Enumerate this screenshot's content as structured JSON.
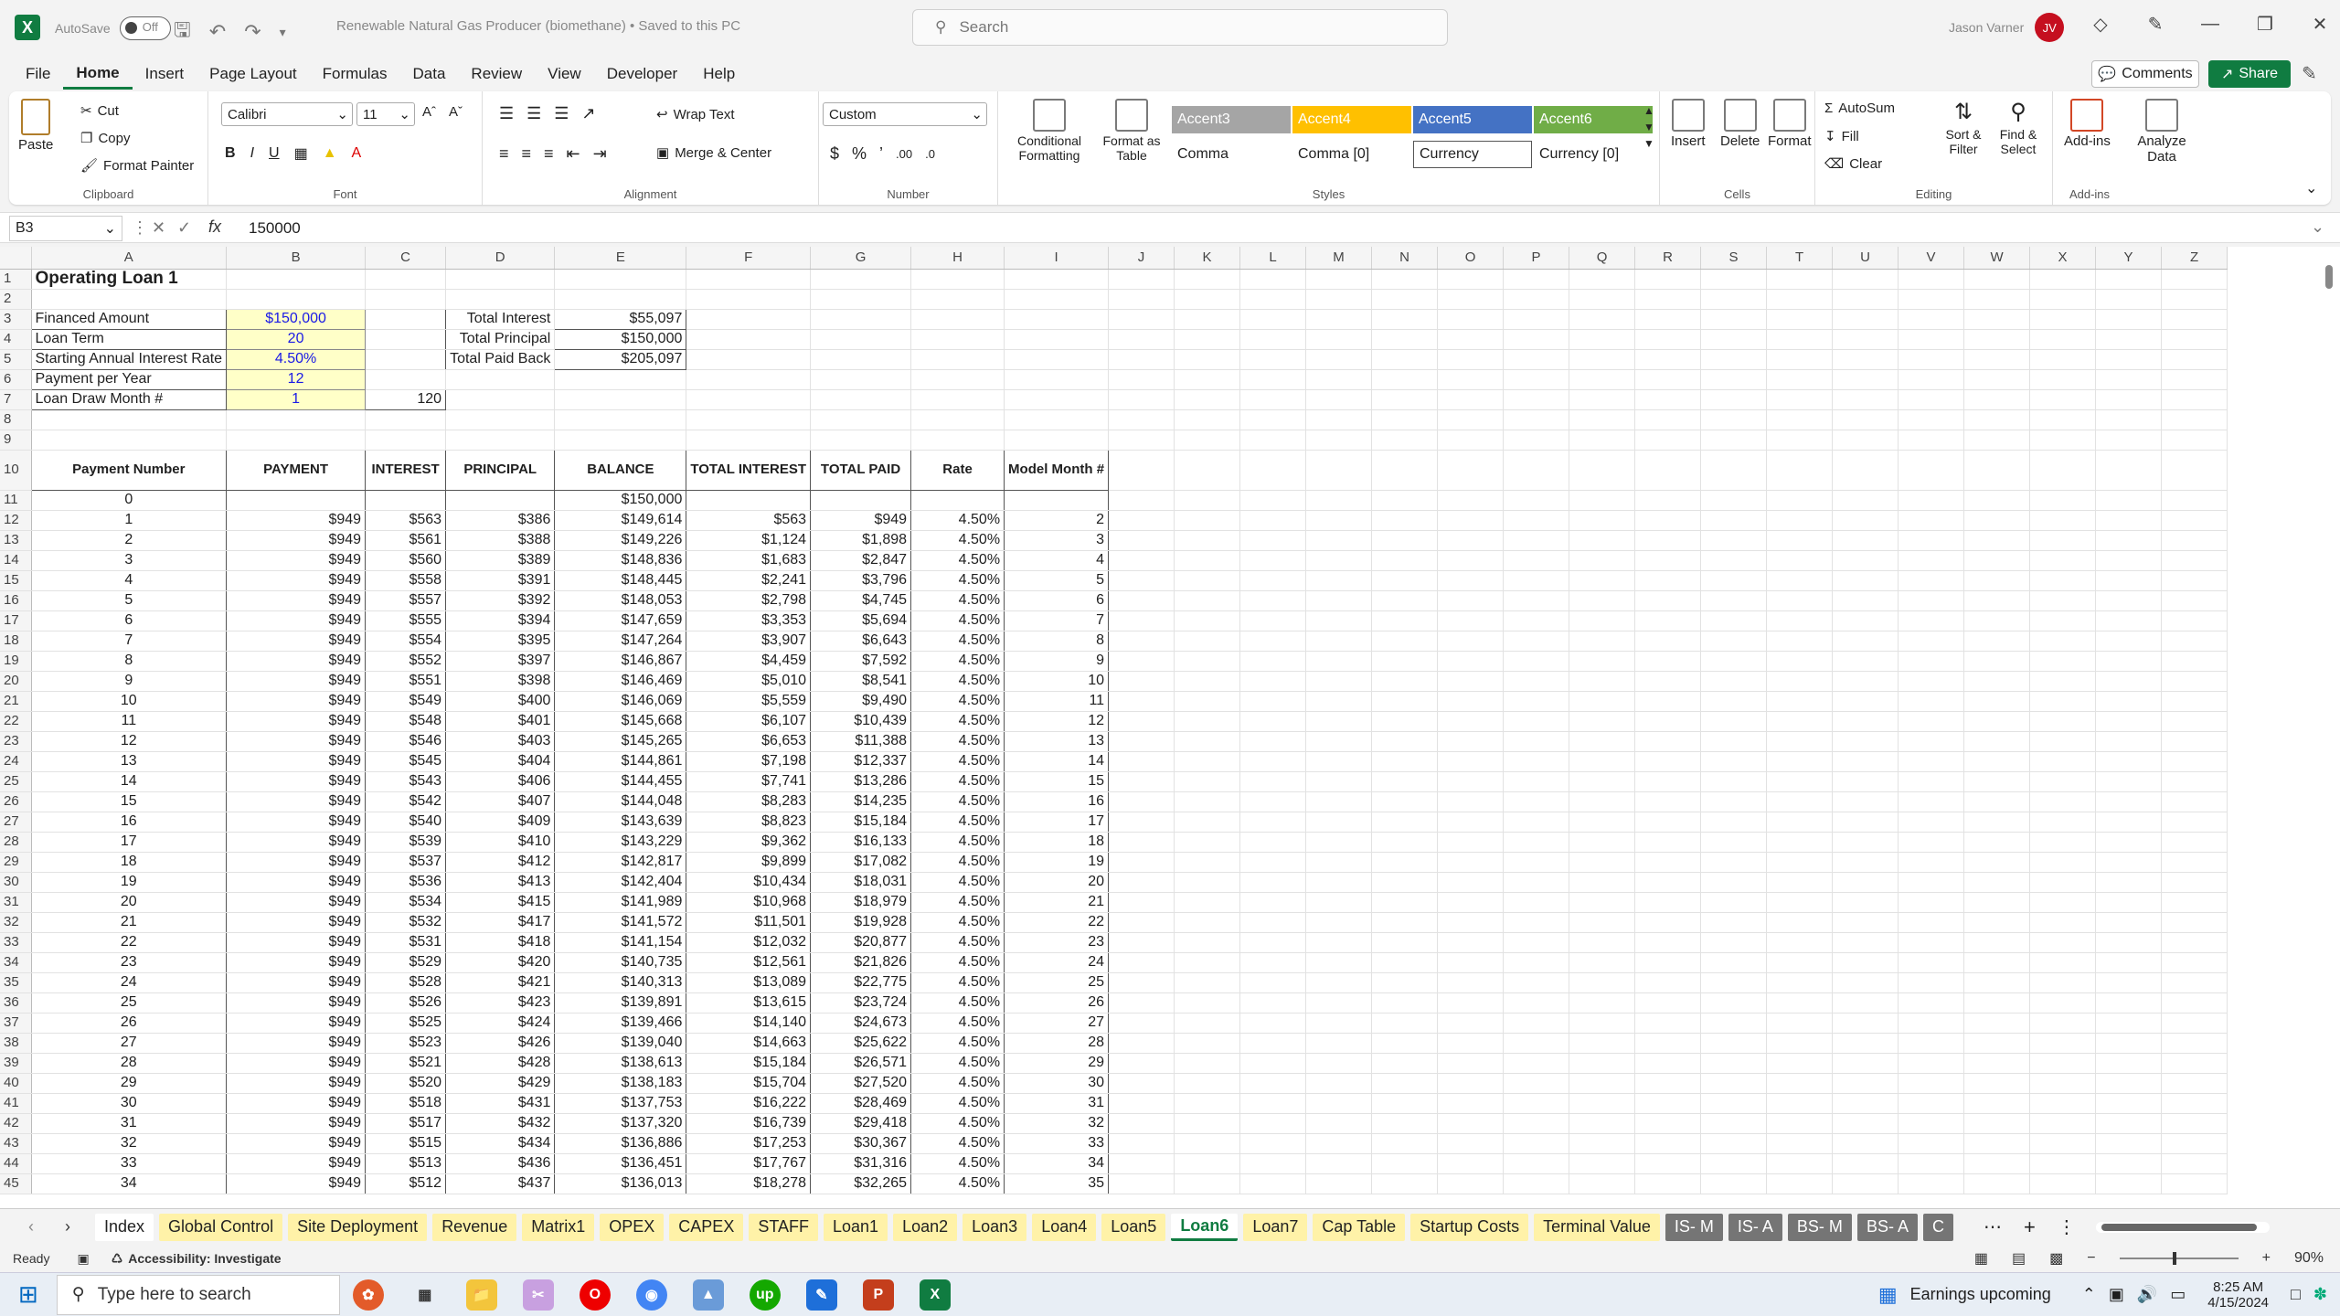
{
  "title": {
    "autosave_label": "AutoSave",
    "autosave_state": "Off",
    "doc_title": "Renewable Natural Gas Producer (biomethane) • Saved to this PC",
    "search_placeholder": "Search",
    "user_name": "Jason Varner",
    "user_initials": "JV"
  },
  "menu": {
    "items": [
      "File",
      "Home",
      "Insert",
      "Page Layout",
      "Formulas",
      "Data",
      "Review",
      "View",
      "Developer",
      "Help"
    ],
    "active": "Home",
    "comments": "Comments",
    "share": "Share"
  },
  "ribbon": {
    "clipboard": {
      "paste": "Paste",
      "cut": "Cut",
      "copy": "Copy",
      "format_painter": "Format Painter",
      "label": "Clipboard"
    },
    "font": {
      "name": "Calibri",
      "size": "11",
      "label": "Font"
    },
    "alignment": {
      "wrap": "Wrap Text",
      "merge": "Merge & Center",
      "label": "Alignment"
    },
    "number": {
      "format": "Custom",
      "label": "Number"
    },
    "styles": {
      "conditional": "Conditional Formatting",
      "format_table": "Format as Table",
      "cells": [
        "Accent3",
        "Accent4",
        "Accent5",
        "Accent6",
        "Comma",
        "Comma [0]",
        "Currency",
        "Currency [0]"
      ],
      "label": "Styles"
    },
    "cells": {
      "insert": "Insert",
      "delete": "Delete",
      "format": "Format",
      "label": "Cells"
    },
    "editing": {
      "autosum": "AutoSum",
      "fill": "Fill",
      "clear": "Clear",
      "sort": "Sort & Filter",
      "find": "Find & Select",
      "label": "Editing"
    },
    "addins": {
      "addins": "Add-ins",
      "analyze": "Analyze Data",
      "label": "Add-ins"
    }
  },
  "formula_bar": {
    "cell_ref": "B3",
    "fx": "fx",
    "value": "150000"
  },
  "columns": [
    "A",
    "B",
    "C",
    "D",
    "E",
    "F",
    "G",
    "H",
    "I",
    "J",
    "K",
    "L",
    "M",
    "N",
    "O",
    "P",
    "Q",
    "R",
    "S",
    "T",
    "U",
    "V",
    "W",
    "X",
    "Y",
    "Z"
  ],
  "sheet": {
    "title": "Operating Loan 1",
    "inputs": [
      [
        "Financed Amount",
        "$150,000"
      ],
      [
        "Loan Term",
        "20"
      ],
      [
        "Starting Annual Interest Rate",
        "4.50%"
      ],
      [
        "Payment per Year",
        "12"
      ],
      [
        "Loan Draw Month #",
        "1"
      ]
    ],
    "draw_month_value": "120",
    "summary": [
      [
        "Total Interest",
        "$55,097"
      ],
      [
        "Total Principal",
        "$150,000"
      ],
      [
        "Total Paid Back",
        "$205,097"
      ]
    ],
    "headers": [
      "Payment Number",
      "PAYMENT",
      "INTEREST",
      "PRINCIPAL",
      "BALANCE",
      "TOTAL INTEREST",
      "TOTAL PAID",
      "Rate",
      "Model Month #"
    ],
    "row0": [
      "0",
      "",
      "",
      "",
      "$150,000",
      "",
      "",
      "",
      ""
    ],
    "rows": [
      [
        "1",
        "$949",
        "$563",
        "$386",
        "$149,614",
        "$563",
        "$949",
        "4.50%",
        "2"
      ],
      [
        "2",
        "$949",
        "$561",
        "$388",
        "$149,226",
        "$1,124",
        "$1,898",
        "4.50%",
        "3"
      ],
      [
        "3",
        "$949",
        "$560",
        "$389",
        "$148,836",
        "$1,683",
        "$2,847",
        "4.50%",
        "4"
      ],
      [
        "4",
        "$949",
        "$558",
        "$391",
        "$148,445",
        "$2,241",
        "$3,796",
        "4.50%",
        "5"
      ],
      [
        "5",
        "$949",
        "$557",
        "$392",
        "$148,053",
        "$2,798",
        "$4,745",
        "4.50%",
        "6"
      ],
      [
        "6",
        "$949",
        "$555",
        "$394",
        "$147,659",
        "$3,353",
        "$5,694",
        "4.50%",
        "7"
      ],
      [
        "7",
        "$949",
        "$554",
        "$395",
        "$147,264",
        "$3,907",
        "$6,643",
        "4.50%",
        "8"
      ],
      [
        "8",
        "$949",
        "$552",
        "$397",
        "$146,867",
        "$4,459",
        "$7,592",
        "4.50%",
        "9"
      ],
      [
        "9",
        "$949",
        "$551",
        "$398",
        "$146,469",
        "$5,010",
        "$8,541",
        "4.50%",
        "10"
      ],
      [
        "10",
        "$949",
        "$549",
        "$400",
        "$146,069",
        "$5,559",
        "$9,490",
        "4.50%",
        "11"
      ],
      [
        "11",
        "$949",
        "$548",
        "$401",
        "$145,668",
        "$6,107",
        "$10,439",
        "4.50%",
        "12"
      ],
      [
        "12",
        "$949",
        "$546",
        "$403",
        "$145,265",
        "$6,653",
        "$11,388",
        "4.50%",
        "13"
      ],
      [
        "13",
        "$949",
        "$545",
        "$404",
        "$144,861",
        "$7,198",
        "$12,337",
        "4.50%",
        "14"
      ],
      [
        "14",
        "$949",
        "$543",
        "$406",
        "$144,455",
        "$7,741",
        "$13,286",
        "4.50%",
        "15"
      ],
      [
        "15",
        "$949",
        "$542",
        "$407",
        "$144,048",
        "$8,283",
        "$14,235",
        "4.50%",
        "16"
      ],
      [
        "16",
        "$949",
        "$540",
        "$409",
        "$143,639",
        "$8,823",
        "$15,184",
        "4.50%",
        "17"
      ],
      [
        "17",
        "$949",
        "$539",
        "$410",
        "$143,229",
        "$9,362",
        "$16,133",
        "4.50%",
        "18"
      ],
      [
        "18",
        "$949",
        "$537",
        "$412",
        "$142,817",
        "$9,899",
        "$17,082",
        "4.50%",
        "19"
      ],
      [
        "19",
        "$949",
        "$536",
        "$413",
        "$142,404",
        "$10,434",
        "$18,031",
        "4.50%",
        "20"
      ],
      [
        "20",
        "$949",
        "$534",
        "$415",
        "$141,989",
        "$10,968",
        "$18,979",
        "4.50%",
        "21"
      ],
      [
        "21",
        "$949",
        "$532",
        "$417",
        "$141,572",
        "$11,501",
        "$19,928",
        "4.50%",
        "22"
      ],
      [
        "22",
        "$949",
        "$531",
        "$418",
        "$141,154",
        "$12,032",
        "$20,877",
        "4.50%",
        "23"
      ],
      [
        "23",
        "$949",
        "$529",
        "$420",
        "$140,735",
        "$12,561",
        "$21,826",
        "4.50%",
        "24"
      ],
      [
        "24",
        "$949",
        "$528",
        "$421",
        "$140,313",
        "$13,089",
        "$22,775",
        "4.50%",
        "25"
      ],
      [
        "25",
        "$949",
        "$526",
        "$423",
        "$139,891",
        "$13,615",
        "$23,724",
        "4.50%",
        "26"
      ],
      [
        "26",
        "$949",
        "$525",
        "$424",
        "$139,466",
        "$14,140",
        "$24,673",
        "4.50%",
        "27"
      ],
      [
        "27",
        "$949",
        "$523",
        "$426",
        "$139,040",
        "$14,663",
        "$25,622",
        "4.50%",
        "28"
      ],
      [
        "28",
        "$949",
        "$521",
        "$428",
        "$138,613",
        "$15,184",
        "$26,571",
        "4.50%",
        "29"
      ],
      [
        "29",
        "$949",
        "$520",
        "$429",
        "$138,183",
        "$15,704",
        "$27,520",
        "4.50%",
        "30"
      ],
      [
        "30",
        "$949",
        "$518",
        "$431",
        "$137,753",
        "$16,222",
        "$28,469",
        "4.50%",
        "31"
      ],
      [
        "31",
        "$949",
        "$517",
        "$432",
        "$137,320",
        "$16,739",
        "$29,418",
        "4.50%",
        "32"
      ],
      [
        "32",
        "$949",
        "$515",
        "$434",
        "$136,886",
        "$17,253",
        "$30,367",
        "4.50%",
        "33"
      ],
      [
        "33",
        "$949",
        "$513",
        "$436",
        "$136,451",
        "$17,767",
        "$31,316",
        "4.50%",
        "34"
      ],
      [
        "34",
        "$949",
        "$512",
        "$437",
        "$136,013",
        "$18,278",
        "$32,265",
        "4.50%",
        "35"
      ]
    ]
  },
  "tabs": [
    {
      "name": "Index",
      "style": "white"
    },
    {
      "name": "Global Control",
      "style": "yellow"
    },
    {
      "name": "Site Deployment",
      "style": "yellow"
    },
    {
      "name": "Revenue",
      "style": "yellow"
    },
    {
      "name": "Matrix1",
      "style": "yellow"
    },
    {
      "name": "OPEX",
      "style": "yellow"
    },
    {
      "name": "CAPEX",
      "style": "yellow"
    },
    {
      "name": "STAFF",
      "style": "yellow"
    },
    {
      "name": "Loan1",
      "style": "yellow"
    },
    {
      "name": "Loan2",
      "style": "yellow"
    },
    {
      "name": "Loan3",
      "style": "yellow"
    },
    {
      "name": "Loan4",
      "style": "yellow"
    },
    {
      "name": "Loan5",
      "style": "yellow"
    },
    {
      "name": "Loan6",
      "style": "active"
    },
    {
      "name": "Loan7",
      "style": "yellow"
    },
    {
      "name": "Cap Table",
      "style": "yellow"
    },
    {
      "name": "Startup Costs",
      "style": "yellow"
    },
    {
      "name": "Terminal Value",
      "style": "yellow"
    },
    {
      "name": "IS- M",
      "style": "gray"
    },
    {
      "name": "IS- A",
      "style": "gray"
    },
    {
      "name": "BS- M",
      "style": "gray"
    },
    {
      "name": "BS- A",
      "style": "gray"
    },
    {
      "name": "C",
      "style": "gray"
    }
  ],
  "status": {
    "ready": "Ready",
    "accessibility": "Accessibility: Investigate",
    "zoom": "90%"
  },
  "taskbar": {
    "search_placeholder": "Type here to search",
    "news": "Earnings upcoming",
    "time": "8:25 AM",
    "date": "4/15/2024"
  }
}
